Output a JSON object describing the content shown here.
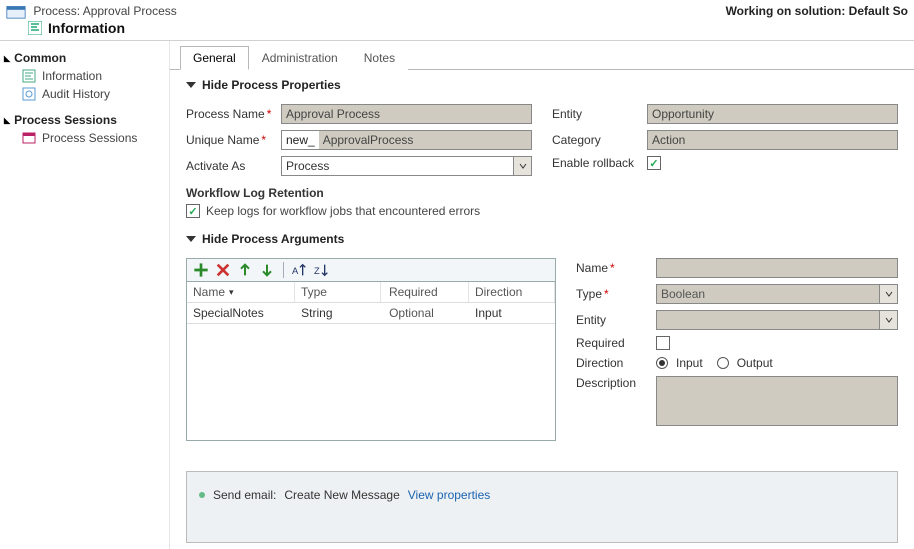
{
  "header": {
    "process_label": "Process: Approval Process",
    "info_title": "Information",
    "working_on": "Working on solution: Default So"
  },
  "sidebar": {
    "common_label": "Common",
    "items_common": [
      {
        "label": "Information"
      },
      {
        "label": "Audit History"
      }
    ],
    "sessions_label": "Process Sessions",
    "items_sessions": [
      {
        "label": "Process Sessions"
      }
    ]
  },
  "tabs": {
    "general": "General",
    "administration": "Administration",
    "notes": "Notes"
  },
  "props": {
    "section_title": "Hide Process Properties",
    "process_name_label": "Process Name",
    "process_name_value": "Approval Process",
    "unique_name_label": "Unique Name",
    "unique_name_prefix": "new_",
    "unique_name_value": "ApprovalProcess",
    "activate_as_label": "Activate As",
    "activate_as_value": "Process",
    "entity_label": "Entity",
    "entity_value": "Opportunity",
    "category_label": "Category",
    "category_value": "Action",
    "enable_rollback_label": "Enable rollback",
    "workflow_log_title": "Workflow Log Retention",
    "workflow_log_option": "Keep logs for workflow jobs that encountered errors"
  },
  "args": {
    "section_title": "Hide Process Arguments",
    "grid_headers": {
      "name": "Name",
      "type": "Type",
      "required": "Required",
      "direction": "Direction"
    },
    "rows": [
      {
        "name": "SpecialNotes",
        "type": "String",
        "required": "Optional",
        "direction": "Input"
      }
    ],
    "detail": {
      "name_label": "Name",
      "type_label": "Type",
      "type_value": "Boolean",
      "entity_label": "Entity",
      "required_label": "Required",
      "direction_label": "Direction",
      "direction_input": "Input",
      "direction_output": "Output",
      "description_label": "Description"
    }
  },
  "steps": {
    "send_email_label": "Send email:",
    "step_title": "Create New Message",
    "view_props": "View properties"
  }
}
